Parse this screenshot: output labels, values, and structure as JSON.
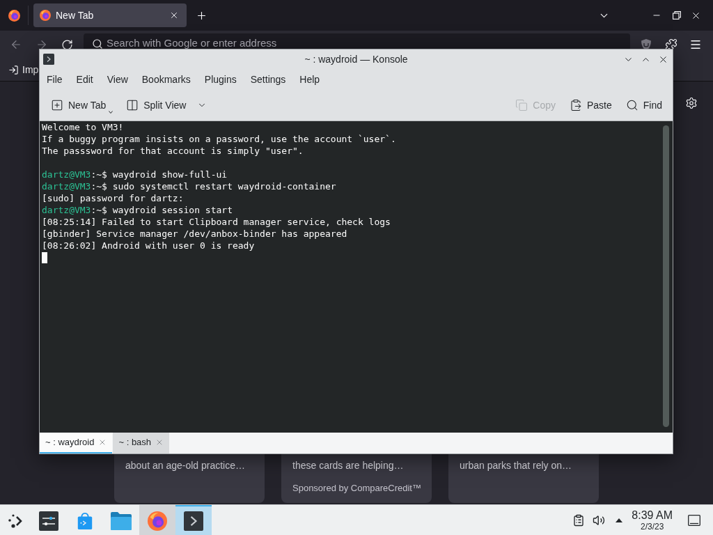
{
  "browser": {
    "tabs": [
      {
        "title": "New Tab",
        "selected": true
      }
    ],
    "navigation": {
      "back_disabled": true,
      "forward_disabled": true
    },
    "address_bar": {
      "placeholder": "Search with Google or enter address"
    },
    "bookmarks": [
      {
        "label": "Imp"
      }
    ],
    "cards": [
      {
        "summary": "about an age-old practice…"
      },
      {
        "summary": "these cards are helping…",
        "sponsor": "Sponsored by CompareCredit™"
      },
      {
        "summary": "urban parks that rely on…"
      }
    ]
  },
  "konsole": {
    "title": "~ : waydroid — Konsole",
    "menu": [
      "File",
      "Edit",
      "View",
      "Bookmarks",
      "Plugins",
      "Settings",
      "Help"
    ],
    "toolbar_left": [
      {
        "kind": "new-tab",
        "label": "New Tab",
        "disabled": false
      },
      {
        "kind": "split-view",
        "label": "Split View",
        "disabled": false
      }
    ],
    "toolbar_right": [
      {
        "kind": "copy",
        "label": "Copy",
        "disabled": true
      },
      {
        "kind": "paste",
        "label": "Paste",
        "disabled": false
      },
      {
        "kind": "find",
        "label": "Find",
        "disabled": false
      }
    ],
    "terminal": {
      "lines": [
        {
          "kind": "output",
          "text": "Welcome to VM3!"
        },
        {
          "kind": "output",
          "text": "If a buggy program insists on a password, use the account `user`."
        },
        {
          "kind": "output",
          "text": "The passsword for that account is simply \"user\"."
        },
        {
          "kind": "blank"
        },
        {
          "kind": "prompt",
          "user": "dartz@VM3",
          "prompt": ":~$",
          "command": "waydroid show-full-ui"
        },
        {
          "kind": "prompt",
          "user": "dartz@VM3",
          "prompt": ":~$",
          "command": "sudo systemctl restart waydroid-container"
        },
        {
          "kind": "output",
          "text": "[sudo] password for dartz:"
        },
        {
          "kind": "prompt",
          "user": "dartz@VM3",
          "prompt": ":~$",
          "command": "waydroid session start"
        },
        {
          "kind": "output",
          "text": "[08:25:14] Failed to start Clipboard manager service, check logs"
        },
        {
          "kind": "output",
          "text": "[gbinder] Service manager /dev/anbox-binder has appeared"
        },
        {
          "kind": "output",
          "text": "[08:26:02] Android with user 0 is ready"
        }
      ],
      "cursor": true
    },
    "tabs": [
      {
        "label": "~ : waydroid",
        "selected": true
      },
      {
        "label": "~ : bash",
        "selected": false
      }
    ]
  },
  "taskbar": {
    "tasks": [
      {
        "kind": "launcher",
        "running": false,
        "selected": false
      },
      {
        "kind": "settings",
        "running": false,
        "selected": false
      },
      {
        "kind": "store",
        "running": false,
        "selected": false
      },
      {
        "kind": "files",
        "running": false,
        "selected": false
      },
      {
        "kind": "browser",
        "running": true,
        "selected": false
      },
      {
        "kind": "terminal",
        "running": true,
        "selected": true
      }
    ],
    "clock": {
      "time": "8:39 AM",
      "date": "2/3/23"
    }
  }
}
